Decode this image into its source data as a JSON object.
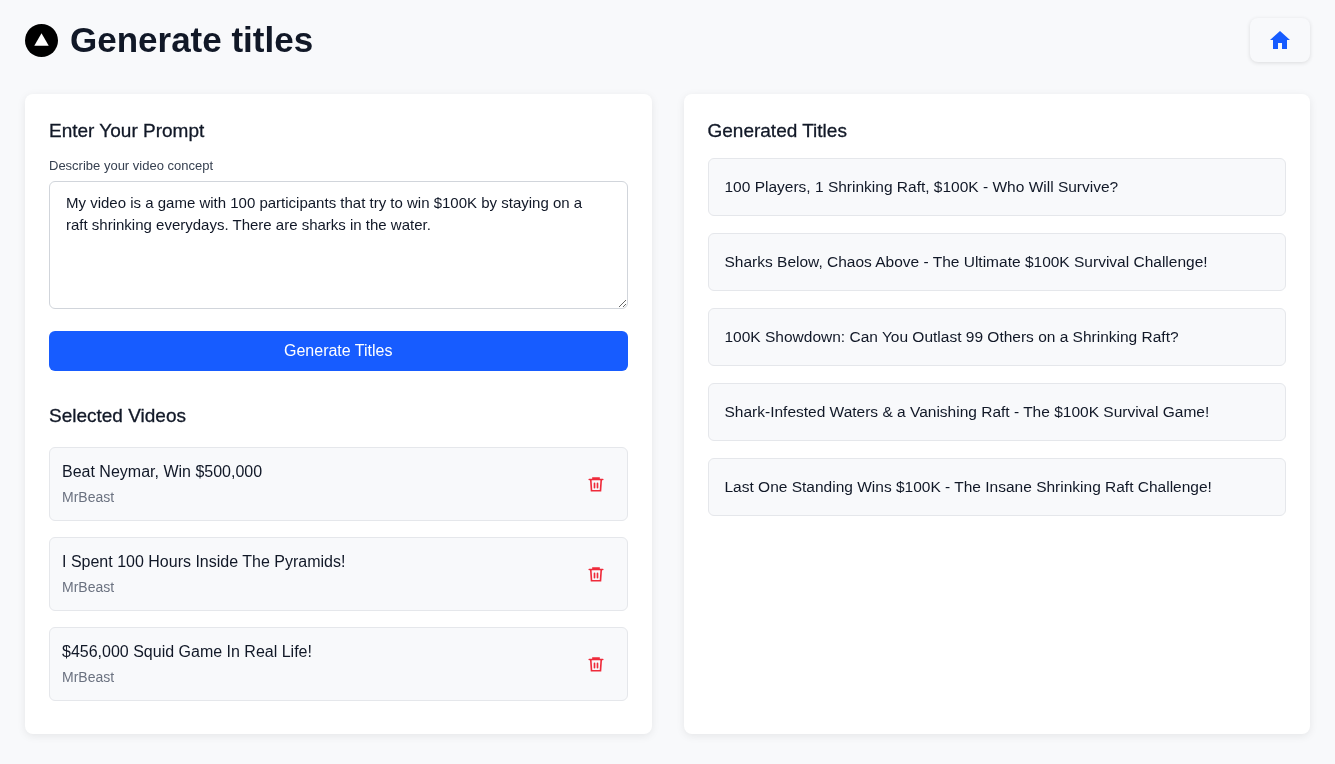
{
  "header": {
    "title": "Generate titles"
  },
  "prompt_panel": {
    "title": "Enter Your Prompt",
    "field_label": "Describe your video concept",
    "prompt": {
      "value": "My video is a game with 100 participants that try to win $100K by staying on a raft shrinking everydays. There are sharks in the water."
    },
    "generate_button": "Generate Titles"
  },
  "selected_videos": {
    "title": "Selected Videos",
    "items": [
      {
        "title": "Beat Neymar, Win $500,000",
        "channel": "MrBeast"
      },
      {
        "title": "I Spent 100 Hours Inside The Pyramids!",
        "channel": "MrBeast"
      },
      {
        "title": "$456,000 Squid Game In Real Life!",
        "channel": "MrBeast"
      }
    ]
  },
  "generated_titles": {
    "title": "Generated Titles",
    "items": [
      "100 Players, 1 Shrinking Raft, $100K - Who Will Survive?",
      "Sharks Below, Chaos Above - The Ultimate $100K Survival Challenge!",
      "100K Showdown: Can You Outlast 99 Others on a Shrinking Raft?",
      "Shark-Infested Waters & a Vanishing Raft - The $100K Survival Game!",
      "Last One Standing Wins $100K - The Insane Shrinking Raft Challenge!"
    ]
  }
}
